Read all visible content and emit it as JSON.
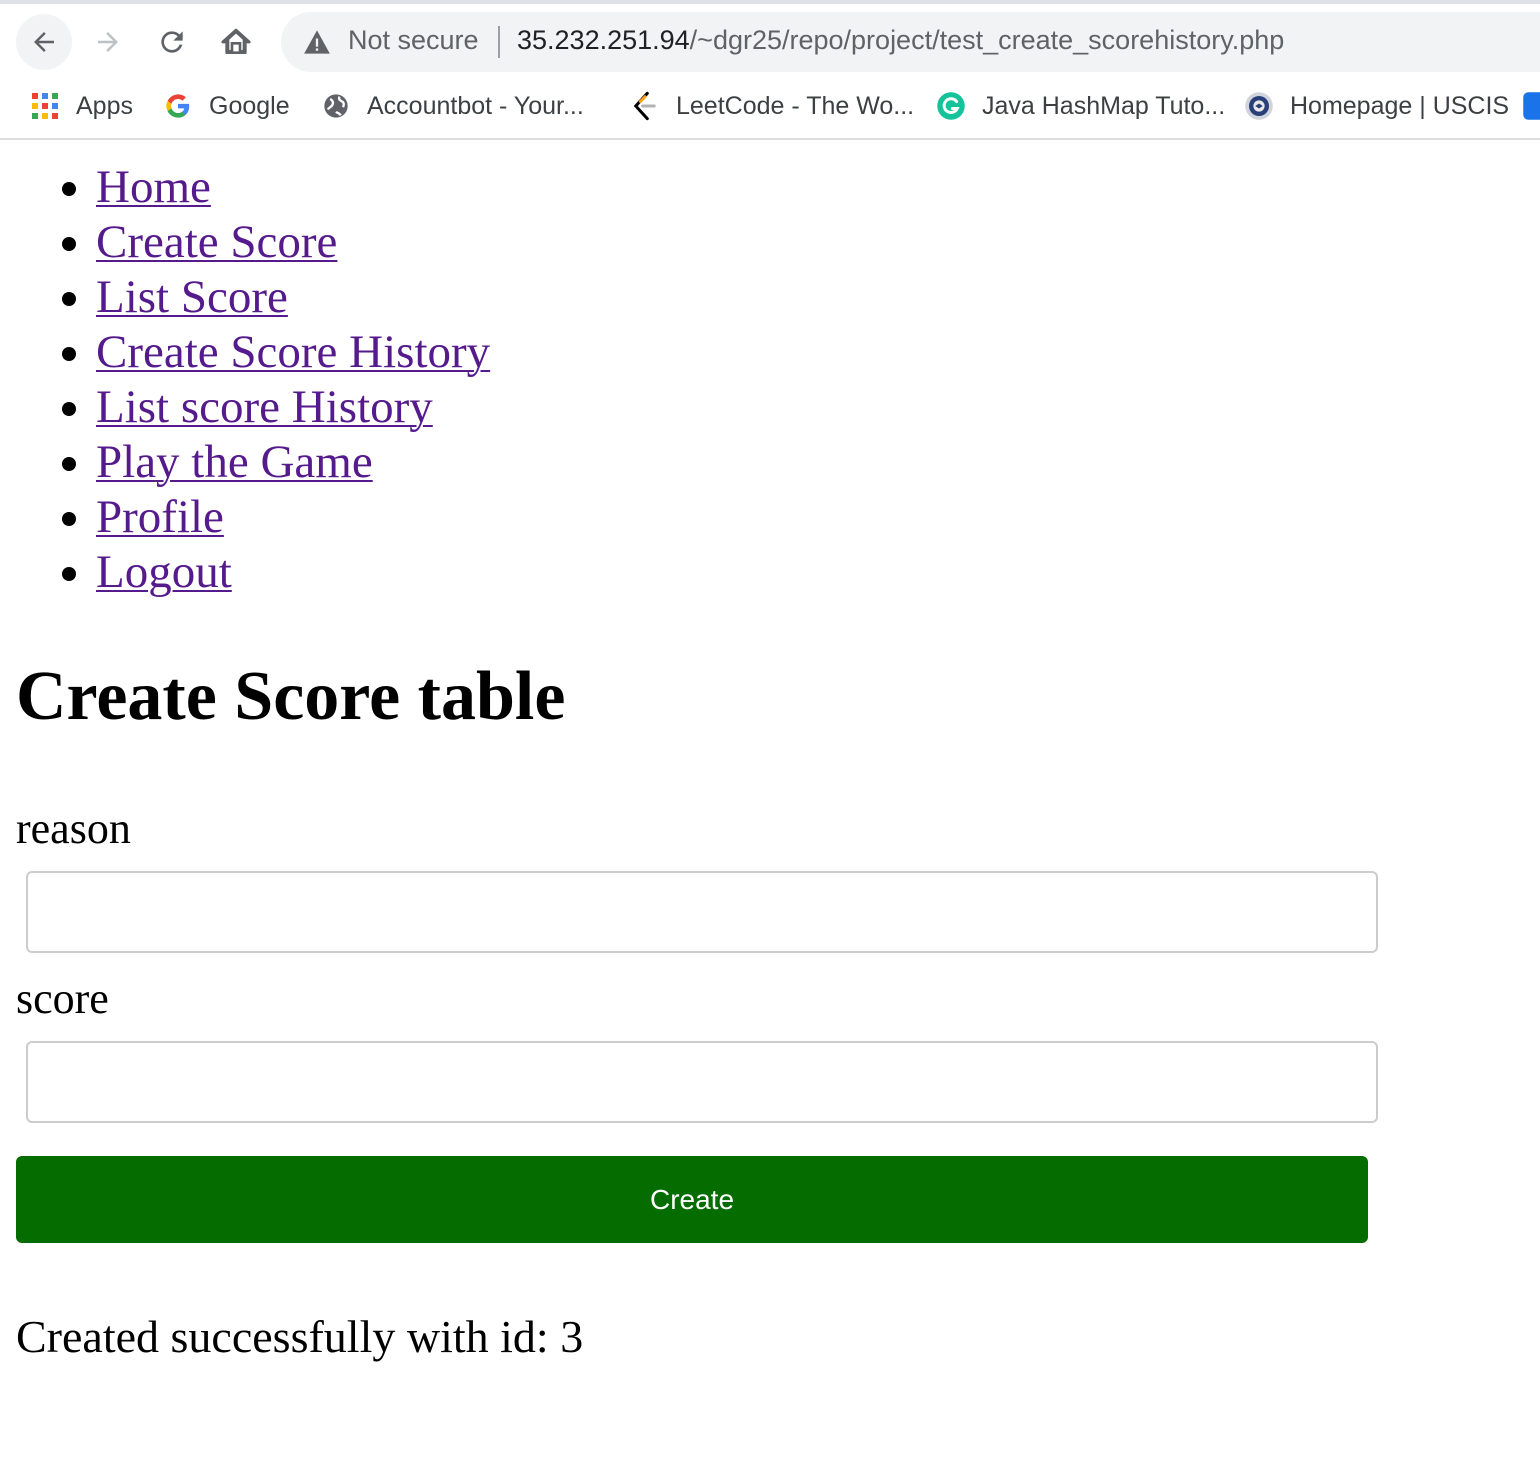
{
  "browser": {
    "security_label": "Not secure",
    "url_host": "35.232.251.94",
    "url_path": "/~dgr25/repo/project/test_create_scorehistory.php",
    "bookmarks": [
      {
        "label": "Apps",
        "icon": "apps-grid-icon"
      },
      {
        "label": "Google",
        "icon": "google-icon"
      },
      {
        "label": "Accountbot - Your...",
        "icon": "globe-icon"
      },
      {
        "label": "LeetCode - The Wo...",
        "icon": "leetcode-icon"
      },
      {
        "label": "Java HashMap Tuto...",
        "icon": "grammarly-icon"
      },
      {
        "label": "Homepage | USCIS",
        "icon": "uscis-seal-icon"
      }
    ]
  },
  "nav": {
    "items": [
      {
        "label": "Home"
      },
      {
        "label": "Create Score"
      },
      {
        "label": "List Score"
      },
      {
        "label": "Create Score History"
      },
      {
        "label": "List score History"
      },
      {
        "label": "Play the Game"
      },
      {
        "label": "Profile"
      },
      {
        "label": "Logout"
      }
    ]
  },
  "form": {
    "title": "Create Score table",
    "reason_label": "reason",
    "reason_value": "",
    "score_label": "score",
    "score_value": "",
    "submit_label": "Create"
  },
  "message": "Created successfully with id: 3",
  "colors": {
    "link": "#551a8b",
    "button": "#056d00"
  }
}
